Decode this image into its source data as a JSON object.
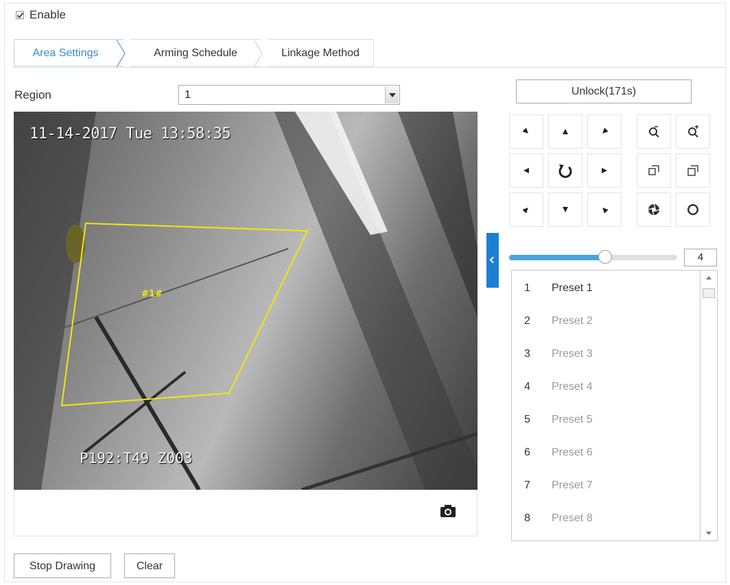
{
  "enable": {
    "label": "Enable",
    "checked": true
  },
  "tabs": [
    {
      "label": "Area Settings",
      "active": true
    },
    {
      "label": "Arming Schedule",
      "active": false
    },
    {
      "label": "Linkage Method",
      "active": false
    }
  ],
  "region": {
    "label": "Region",
    "value": "1"
  },
  "video": {
    "osd_time": "11-14-2017 Tue 13:58:35",
    "osd_ptz": "P192:T49   Z003",
    "region_tag": "#1#",
    "region_color": "#f1e80b"
  },
  "ptz": {
    "unlock_label": "Unlock(171s)",
    "buttons": [
      "pan-left-up-icon",
      "pan-up-icon",
      "pan-right-up-icon",
      "zoom-out-icon",
      "zoom-in-icon",
      "pan-left-icon",
      "auto-rotate-icon",
      "pan-right-icon",
      "focus-near-icon",
      "focus-far-icon",
      "pan-left-down-icon",
      "pan-down-icon",
      "pan-right-down-icon",
      "iris-close-icon",
      "iris-open-icon"
    ],
    "speed": {
      "value": "4",
      "fraction": 0.57
    }
  },
  "presets": [
    {
      "num": "1",
      "name": "Preset 1"
    },
    {
      "num": "2",
      "name": "Preset 2"
    },
    {
      "num": "3",
      "name": "Preset 3"
    },
    {
      "num": "4",
      "name": "Preset 4"
    },
    {
      "num": "5",
      "name": "Preset 5"
    },
    {
      "num": "6",
      "name": "Preset 6"
    },
    {
      "num": "7",
      "name": "Preset 7"
    },
    {
      "num": "8",
      "name": "Preset 8"
    }
  ],
  "actions": {
    "stop_drawing": "Stop Drawing",
    "clear": "Clear"
  },
  "colors": {
    "accent": "#3a8cc6",
    "slider": "#4aa3df",
    "collapse": "#1c7fd4"
  }
}
